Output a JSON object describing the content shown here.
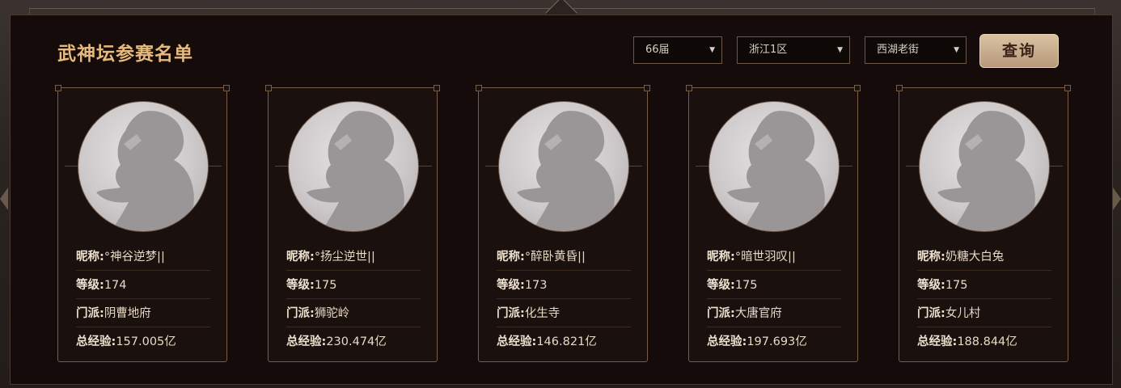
{
  "header": {
    "title": "武神坛参赛名单"
  },
  "filters": {
    "session": "66届",
    "region": "浙江1区",
    "server": "西湖老街",
    "query_label": "查询"
  },
  "labels": {
    "nickname": "昵称:",
    "level": "等级:",
    "school": "门派:",
    "exp": "总经验:"
  },
  "players": [
    {
      "nickname": "°神谷逆梦||",
      "level": "174",
      "school": "阴曹地府",
      "exp": "157.005亿"
    },
    {
      "nickname": "°扬尘逆世||",
      "level": "175",
      "school": "狮驼岭",
      "exp": "230.474亿"
    },
    {
      "nickname": "°醉卧黄昏||",
      "level": "173",
      "school": "化生寺",
      "exp": "146.821亿"
    },
    {
      "nickname": "°暗世羽叹||",
      "level": "175",
      "school": "大唐官府",
      "exp": "197.693亿"
    },
    {
      "nickname": "奶糖大白兔",
      "level": "175",
      "school": "女儿村",
      "exp": "188.844亿"
    }
  ],
  "colors": {
    "title": "#e6b97c",
    "panel_bg": "#140b0a",
    "card_border": "#7a5d49",
    "button_bg": "#c9ac8c"
  },
  "icons": {
    "dropdown": "triangle-down-icon",
    "avatar": "silhouette-placeholder-icon"
  }
}
